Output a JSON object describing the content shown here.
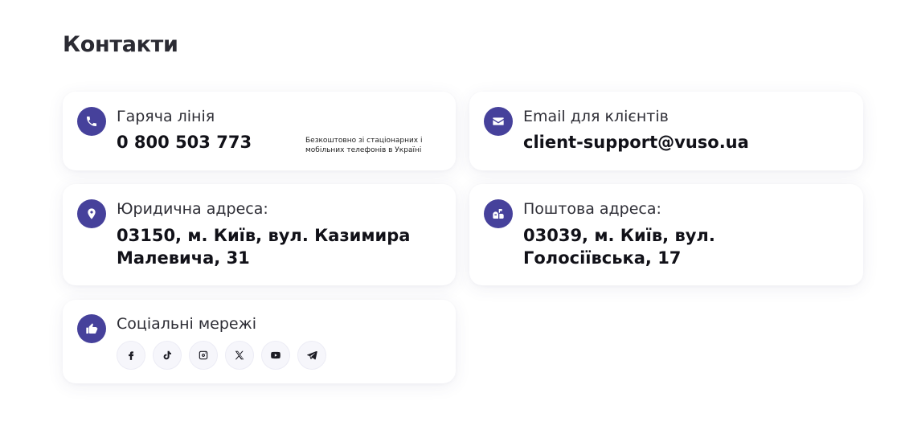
{
  "page": {
    "title": "Контакти"
  },
  "cards": {
    "hotline": {
      "label": "Гаряча лінія",
      "value": "0 800 503 773",
      "note": "Безкоштовно зі стаціонарних і мобільних телефонів в Україні",
      "icon": "phone-icon"
    },
    "email": {
      "label": "Email для клієнтів",
      "value": "client-support@vuso.ua",
      "icon": "envelope-icon"
    },
    "legal_address": {
      "label": "Юридична адреса:",
      "value": "03150, м. Київ, вул. Казимира Малевича, 31",
      "icon": "location-pin-icon"
    },
    "postal_address": {
      "label": "Поштова адреса:",
      "value": "03039, м. Київ, вул. Голосіївська, 17",
      "icon": "mailbox-icon"
    },
    "social": {
      "label": "Соціальні мережі",
      "icon": "thumbs-up-icon",
      "networks": [
        "facebook",
        "tiktok",
        "instagram",
        "x",
        "youtube",
        "telegram"
      ]
    }
  },
  "colors": {
    "accent": "#46419b",
    "card_bg": "#ffffff",
    "social_btn_bg": "#f6f6fb",
    "text": "#111118"
  }
}
